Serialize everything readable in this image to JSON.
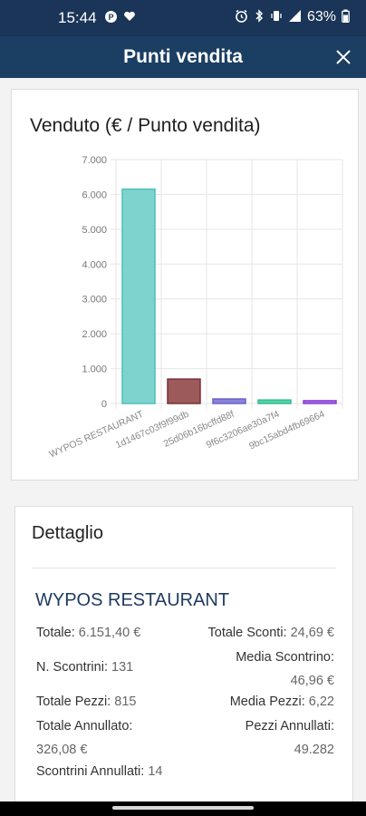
{
  "status_bar": {
    "time": "15:44",
    "battery": "63%",
    "icons_left": [
      "p-icon",
      "heart-icon"
    ],
    "icons_right": [
      "alarm-icon",
      "bluetooth-icon",
      "vibrate-icon",
      "signal-icon",
      "battery-icon"
    ]
  },
  "header": {
    "title": "Punti vendita",
    "close_icon": "close-icon"
  },
  "chart_data": {
    "type": "bar",
    "title": "Venduto (€ / Punto vendita)",
    "categories": [
      "WYPOS RESTAURANT",
      "1d1467c03f9f99db",
      "25d06b16bcffd88f",
      "9f6c3206ae30a7f4",
      "9bc15abd4fb69664"
    ],
    "values": [
      6151.4,
      700,
      130,
      100,
      80
    ],
    "ylim": [
      0,
      7000
    ],
    "yticks": [
      "0",
      "1.000",
      "2.000",
      "3.000",
      "4.000",
      "5.000",
      "6.000",
      "7.000"
    ],
    "colors": [
      "#7fd3cf",
      "#9c5a5a",
      "#8a84d8",
      "#5ad0a8",
      "#a46be0"
    ],
    "stroke_colors": [
      "#4bbfb9",
      "#7a2f35",
      "#6b63c9",
      "#2fbf8c",
      "#8c3fd6"
    ],
    "grid": true
  },
  "detail": {
    "title": "Dettaglio",
    "store_name": "WYPOS RESTAURANT",
    "totale_label": "Totale:",
    "totale_value": "6.151,40 €",
    "sconti_label": "Totale Sconti:",
    "sconti_value": "24,69 €",
    "scontrini_label": "N. Scontrini:",
    "scontrini_value": "131",
    "media_scontrino_label": "Media Scontrino:",
    "media_scontrino_value": "46,96 €",
    "pezzi_label": "Totale Pezzi:",
    "pezzi_value": "815",
    "media_pezzi_label": "Media Pezzi:",
    "media_pezzi_value": "6,22",
    "annullato_label": "Totale Annullato:",
    "annullato_value": "326,08 €",
    "pezzi_annullati_label": "Pezzi Annullati:",
    "pezzi_annullati_value": "49.282",
    "scontrini_annullati_label": "Scontrini Annullati:",
    "scontrini_annullati_value": "14"
  }
}
